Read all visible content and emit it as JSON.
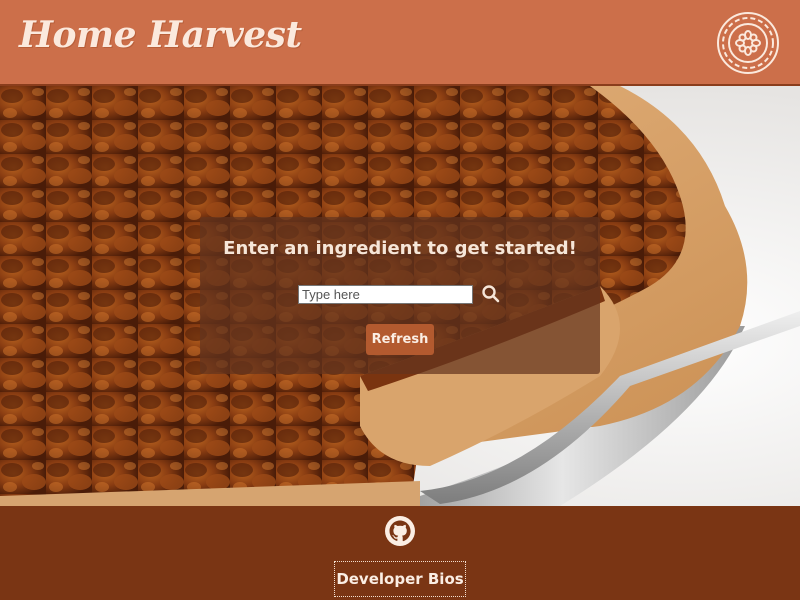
{
  "header": {
    "brand": "Home Harvest",
    "logo_icon": "flower-badge-icon"
  },
  "hero": {
    "image_icon": "pecan-pie-photo"
  },
  "search": {
    "title": "Enter an ingredient to get started!",
    "placeholder": "Type here",
    "value": "",
    "search_icon": "search-icon",
    "refresh_label": "Refresh"
  },
  "footer": {
    "github_icon": "github-icon",
    "bios_label": "Developer Bios"
  },
  "colors": {
    "header_bg": "#cc6f4a",
    "footer_bg": "#7a3514",
    "panel_bg": "rgba(100,52,30,0.72)",
    "button_bg": "#b35a2f",
    "text_light": "#fbeee4"
  }
}
